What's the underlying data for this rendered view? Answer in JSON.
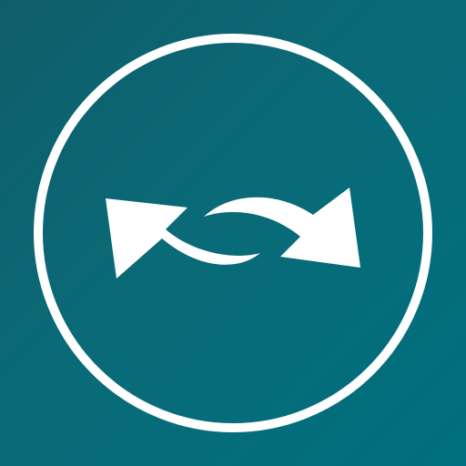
{
  "icon": {
    "name": "sync-arrows-icon",
    "background_start": "#0f5d6a",
    "background_end": "#006f7f",
    "foreground": "#ffffff"
  }
}
